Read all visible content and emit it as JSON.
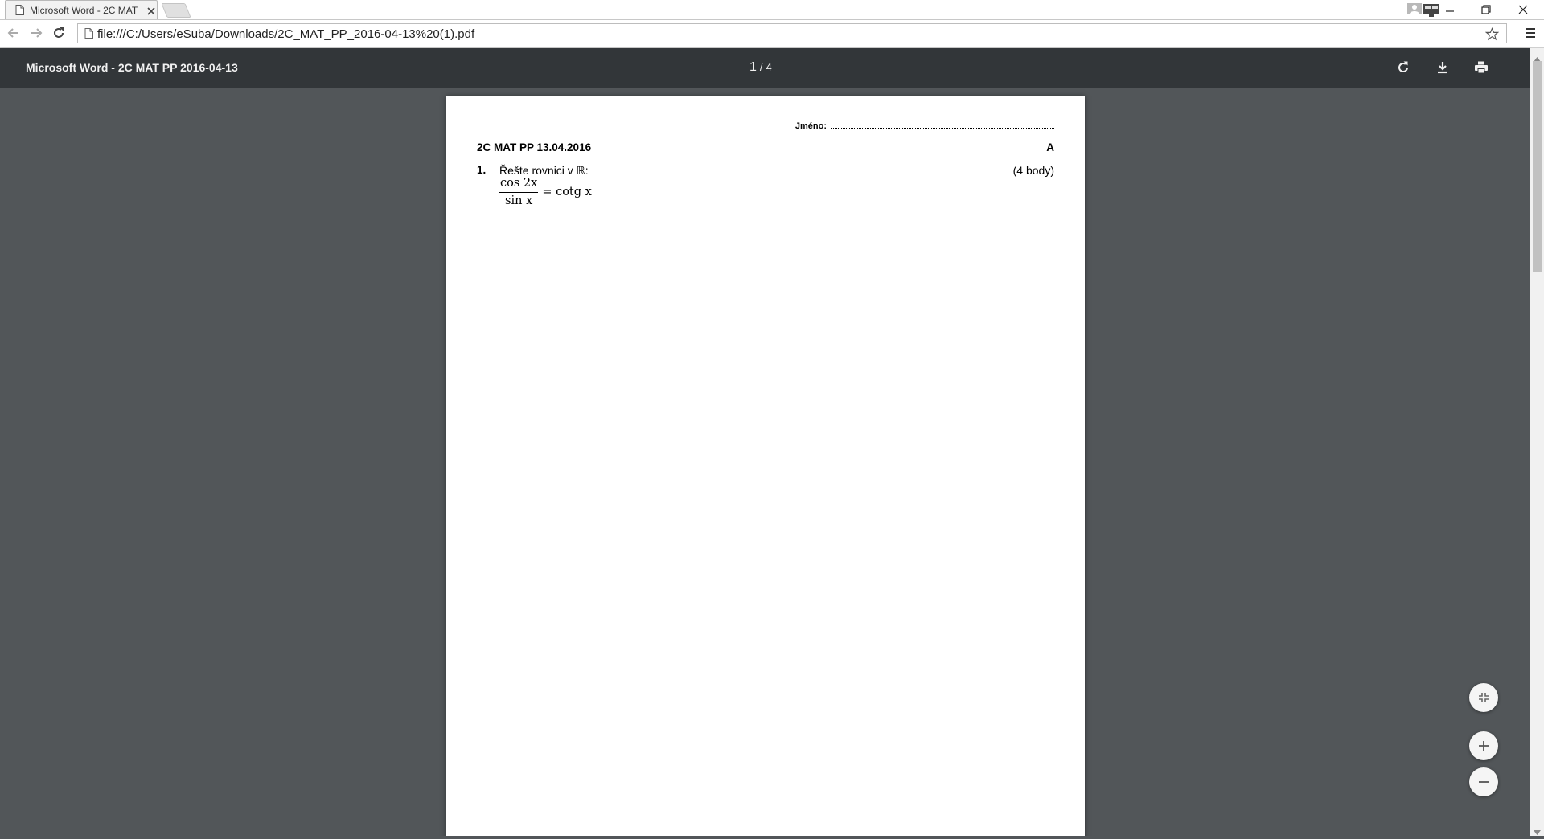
{
  "browser": {
    "tab": {
      "title": "Microsoft Word - 2C MAT"
    },
    "address_bar": {
      "url": "file:///C:/Users/eSuba/Downloads/2C_MAT_PP_2016-04-13%20(1).pdf"
    }
  },
  "pdf_viewer": {
    "title": "Microsoft Word - 2C MAT PP 2016-04-13",
    "page_current": "1",
    "page_separator": "/",
    "page_total": "4"
  },
  "document": {
    "name_label": "Jméno:",
    "test_header": "2C MAT PP 13.04.2016",
    "variant": "A",
    "question": {
      "number": "1.",
      "text": "Řešte rovnici v ℝ:",
      "points": "(4 body)",
      "eq_numerator": "cos 2x",
      "eq_denominator": "sin x",
      "eq_rhs": "= cotg x"
    }
  },
  "icons": {
    "tab": [
      "page-icon",
      "close-icon"
    ],
    "toolbar": [
      "back-arrow-icon",
      "forward-arrow-icon",
      "reload-icon",
      "star-icon",
      "menu-icon"
    ],
    "pdf_bar": [
      "rotate-icon",
      "download-icon",
      "print-icon"
    ],
    "zoom": [
      "fit-to-page-icon",
      "zoom-in-icon",
      "zoom-out-icon"
    ]
  },
  "colors": {
    "pdf_toolbar": "#323639",
    "viewer_background": "#525659",
    "page": "#ffffff"
  }
}
